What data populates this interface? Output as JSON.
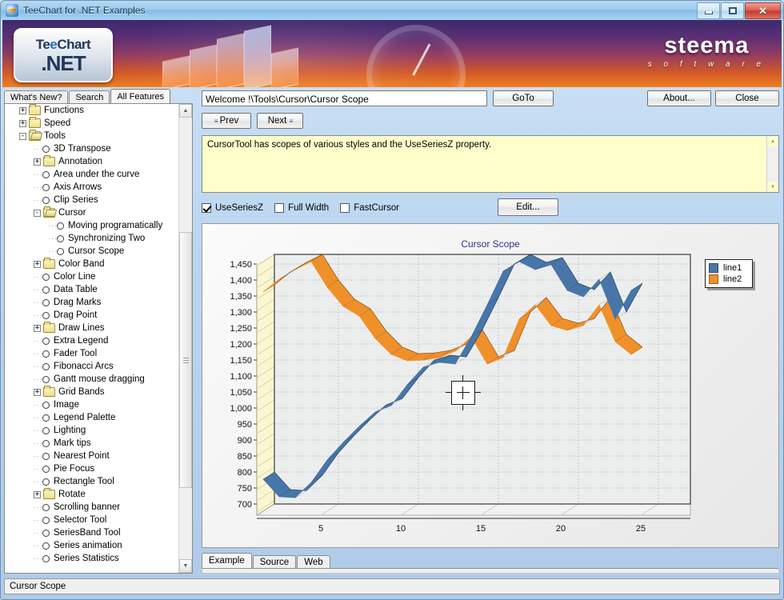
{
  "window": {
    "title": "TeeChart for .NET Examples",
    "icon": "teechart-icon",
    "controls": {
      "minimize": "minimize",
      "maximize": "maximize",
      "close": "close"
    }
  },
  "banner": {
    "logo_line1_a": "Te",
    "logo_line1_o": "e",
    "logo_line1_b": "Chart",
    "logo_line2": ".NET",
    "brand": "steema",
    "brand_sub": "s o f t w a r e"
  },
  "left_tabs": [
    {
      "label": "What's New?",
      "active": false
    },
    {
      "label": "Search",
      "active": false
    },
    {
      "label": "All Features",
      "active": true
    }
  ],
  "tree": [
    {
      "label": "Functions",
      "type": "folder",
      "indent": 1,
      "expander": "+",
      "selected": false
    },
    {
      "label": "Speed",
      "type": "folder",
      "indent": 1,
      "expander": "+",
      "selected": false
    },
    {
      "label": "Tools",
      "type": "folder-open",
      "indent": 1,
      "expander": "-",
      "selected": false
    },
    {
      "label": "3D Transpose",
      "type": "leaf",
      "indent": 2,
      "expander": "",
      "selected": false
    },
    {
      "label": "Annotation",
      "type": "folder",
      "indent": 2,
      "expander": "+",
      "selected": false
    },
    {
      "label": "Area under the curve",
      "type": "leaf",
      "indent": 2,
      "expander": "",
      "selected": false
    },
    {
      "label": "Axis Arrows",
      "type": "leaf",
      "indent": 2,
      "expander": "",
      "selected": false
    },
    {
      "label": "Clip Series",
      "type": "leaf",
      "indent": 2,
      "expander": "",
      "selected": false
    },
    {
      "label": "Cursor",
      "type": "folder-open",
      "indent": 2,
      "expander": "-",
      "selected": false
    },
    {
      "label": "Moving programatically",
      "type": "leaf",
      "indent": 3,
      "expander": "",
      "selected": false
    },
    {
      "label": "Synchronizing Two",
      "type": "leaf",
      "indent": 3,
      "expander": "",
      "selected": false
    },
    {
      "label": "Cursor Scope",
      "type": "leaf",
      "indent": 3,
      "expander": "",
      "selected": true
    },
    {
      "label": "Color Band",
      "type": "folder",
      "indent": 2,
      "expander": "+",
      "selected": false
    },
    {
      "label": "Color Line",
      "type": "leaf",
      "indent": 2,
      "expander": "",
      "selected": false
    },
    {
      "label": "Data Table",
      "type": "leaf",
      "indent": 2,
      "expander": "",
      "selected": false
    },
    {
      "label": "Drag Marks",
      "type": "leaf",
      "indent": 2,
      "expander": "",
      "selected": false
    },
    {
      "label": "Drag Point",
      "type": "leaf",
      "indent": 2,
      "expander": "",
      "selected": false
    },
    {
      "label": "Draw Lines",
      "type": "folder",
      "indent": 2,
      "expander": "+",
      "selected": false
    },
    {
      "label": "Extra Legend",
      "type": "leaf",
      "indent": 2,
      "expander": "",
      "selected": false
    },
    {
      "label": "Fader Tool",
      "type": "leaf",
      "indent": 2,
      "expander": "",
      "selected": false
    },
    {
      "label": "Fibonacci Arcs",
      "type": "leaf",
      "indent": 2,
      "expander": "",
      "selected": false
    },
    {
      "label": "Gantt mouse dragging",
      "type": "leaf",
      "indent": 2,
      "expander": "",
      "selected": false
    },
    {
      "label": "Grid Bands",
      "type": "folder",
      "indent": 2,
      "expander": "+",
      "selected": false
    },
    {
      "label": "Image",
      "type": "leaf",
      "indent": 2,
      "expander": "",
      "selected": false
    },
    {
      "label": "Legend Palette",
      "type": "leaf",
      "indent": 2,
      "expander": "",
      "selected": false
    },
    {
      "label": "Lighting",
      "type": "leaf",
      "indent": 2,
      "expander": "",
      "selected": false
    },
    {
      "label": "Mark tips",
      "type": "leaf",
      "indent": 2,
      "expander": "",
      "selected": false
    },
    {
      "label": "Nearest Point",
      "type": "leaf",
      "indent": 2,
      "expander": "",
      "selected": false
    },
    {
      "label": "Pie Focus",
      "type": "leaf",
      "indent": 2,
      "expander": "",
      "selected": false
    },
    {
      "label": "Rectangle Tool",
      "type": "leaf",
      "indent": 2,
      "expander": "",
      "selected": false
    },
    {
      "label": "Rotate",
      "type": "folder",
      "indent": 2,
      "expander": "+",
      "selected": false
    },
    {
      "label": "Scrolling banner",
      "type": "leaf",
      "indent": 2,
      "expander": "",
      "selected": false
    },
    {
      "label": "Selector Tool",
      "type": "leaf",
      "indent": 2,
      "expander": "",
      "selected": false
    },
    {
      "label": "SeriesBand Tool",
      "type": "leaf",
      "indent": 2,
      "expander": "",
      "selected": false
    },
    {
      "label": "Series animation",
      "type": "leaf",
      "indent": 2,
      "expander": "",
      "selected": false
    },
    {
      "label": "Series Statistics",
      "type": "leaf",
      "indent": 2,
      "expander": "",
      "selected": false
    }
  ],
  "toolbar": {
    "address_value": "Welcome !\\Tools\\Cursor\\Cursor Scope",
    "address_placeholder": "",
    "goto_label": "GoTo",
    "about_label": "About...",
    "close_label": "Close",
    "prev_label": "Prev",
    "next_label": "Next"
  },
  "description": {
    "text": "CursorTool has scopes of various styles and the UseSeriesZ property."
  },
  "options": {
    "checkboxes": [
      {
        "label": "UseSeriesZ",
        "checked": true
      },
      {
        "label": "Full Width",
        "checked": false
      },
      {
        "label": "FastCursor",
        "checked": false
      }
    ],
    "edit_label": "Edit..."
  },
  "bottom_tabs": [
    {
      "label": "Example",
      "active": true
    },
    {
      "label": "Source",
      "active": false
    },
    {
      "label": "Web",
      "active": false
    }
  ],
  "status": {
    "text": "Cursor Scope"
  },
  "chart_data": {
    "type": "line",
    "title": "Cursor Scope",
    "xlabel": "",
    "ylabel": "",
    "xlim": [
      1,
      27
    ],
    "ylim": [
      700,
      1480
    ],
    "xticks": [
      5,
      10,
      15,
      20,
      25
    ],
    "yticks": [
      700,
      750,
      800,
      850,
      900,
      950,
      1000,
      1050,
      1100,
      1150,
      1200,
      1250,
      1300,
      1350,
      1400,
      1450
    ],
    "ytick_labels": [
      "700",
      "750",
      "800",
      "850",
      "900",
      "950",
      "1,000",
      "1,050",
      "1,100",
      "1,150",
      "1,200",
      "1,250",
      "1,300",
      "1,350",
      "1,400",
      "1,450"
    ],
    "grid": true,
    "legend_position": "right-top",
    "colors": {
      "line1": "#4876a8",
      "line2": "#f0902a",
      "title": "#33338f",
      "plot_bg": "#eceeee",
      "wall": "#fbf6d2"
    },
    "x": [
      1,
      2,
      3,
      4,
      5,
      6,
      7,
      8,
      9,
      10,
      11,
      12,
      13,
      14,
      15,
      16,
      17,
      18,
      19,
      20,
      21,
      22,
      23,
      24
    ],
    "series": [
      {
        "name": "line1",
        "color": "#4876a8",
        "values": [
          800,
          745,
          742,
          790,
          860,
          915,
          965,
          1010,
          1030,
          1095,
          1150,
          1165,
          1160,
          1245,
          1345,
          1450,
          1480,
          1455,
          1470,
          1390,
          1370,
          1425,
          1300,
          1390
        ]
      },
      {
        "name": "line2",
        "color": "#f0902a",
        "values": [
          1385,
          1425,
          1455,
          1480,
          1400,
          1340,
          1310,
          1240,
          1190,
          1170,
          1172,
          1180,
          1200,
          1245,
          1160,
          1180,
          1300,
          1345,
          1280,
          1265,
          1280,
          1345,
          1230,
          1190
        ]
      }
    ]
  }
}
